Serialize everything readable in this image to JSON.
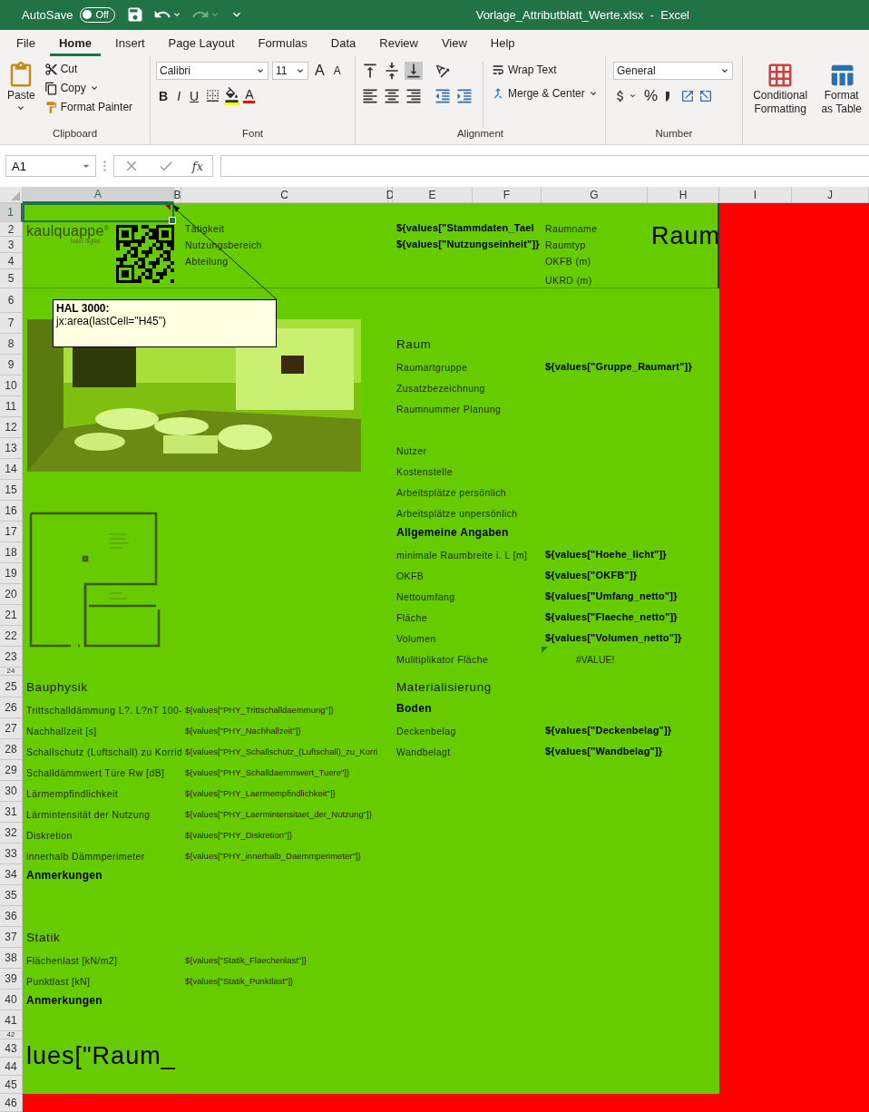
{
  "title_bar": {
    "autosave": {
      "label": "AutoSave",
      "on": false,
      "state_text": "Off"
    },
    "document_title": "Vorlage_Attributblatt_Werte.xlsx  -  Excel"
  },
  "menu_tabs": [
    {
      "label": "File",
      "selected": false
    },
    {
      "label": "Home",
      "selected": true
    },
    {
      "label": "Insert",
      "selected": false
    },
    {
      "label": "Page Layout",
      "selected": false
    },
    {
      "label": "Formulas",
      "selected": false
    },
    {
      "label": "Data",
      "selected": false
    },
    {
      "label": "Review",
      "selected": false
    },
    {
      "label": "View",
      "selected": false
    },
    {
      "label": "Help",
      "selected": false
    }
  ],
  "ribbon": {
    "clipboard": {
      "paste": "Paste",
      "cut": "Cut",
      "copy": "Copy",
      "format_painter": "Format Painter",
      "label": "Clipboard"
    },
    "font": {
      "font_name": "Calibri",
      "font_size": "11",
      "grow": "A",
      "shrink": "A",
      "bold": "B",
      "italic": "I",
      "underline": "U",
      "font_color": "A",
      "label": "Font"
    },
    "alignment": {
      "wrap_text": "Wrap Text",
      "merge_center": "Merge & Center",
      "label": "Alignment"
    },
    "number": {
      "format": "General",
      "percent": "%",
      "label": "Number"
    },
    "styles": [
      {
        "label": "Conditional Formatting"
      },
      {
        "label": "Format as Table"
      }
    ]
  },
  "formula_bar": {
    "name_box": "A1",
    "function_label": "fx"
  },
  "sheet": {
    "columns": [
      {
        "label": "A",
        "selected": true
      },
      {
        "label": "B",
        "selected": false
      },
      {
        "label": "C",
        "selected": false
      },
      {
        "label": "D",
        "selected": false
      },
      {
        "label": "E",
        "selected": false
      },
      {
        "label": "F",
        "selected": false
      },
      {
        "label": "G",
        "selected": false
      },
      {
        "label": "H",
        "selected": false
      },
      {
        "label": "I",
        "selected": false
      },
      {
        "label": "J",
        "selected": false
      }
    ],
    "rows": [
      {
        "label": "1",
        "selected": true
      },
      {
        "label": "2",
        "selected": false,
        "cells": {
          "C": {
            "kind": "label",
            "text": "Tätigkeit"
          },
          "E": {
            "kind": "bold",
            "text": "${values[\"Stammdaten_Tael"
          },
          "G": {
            "kind": "label",
            "text": "Raumname"
          },
          "H": {
            "kind": "title",
            "text": "Raum"
          }
        }
      },
      {
        "label": "3",
        "selected": false,
        "cells": {
          "C": {
            "kind": "label",
            "text": "Nutzungsbereich"
          },
          "E": {
            "kind": "bold",
            "text": "${values[\"Nutzungseinheit\"]}"
          },
          "G": {
            "kind": "label",
            "text": "Raumtyp"
          }
        }
      },
      {
        "label": "4",
        "selected": false,
        "cells": {
          "C": {
            "kind": "label",
            "text": "Abteilung"
          },
          "G": {
            "kind": "label",
            "text": "OKFB (m)"
          }
        }
      },
      {
        "label": "5",
        "selected": false,
        "cells": {
          "G": {
            "kind": "label",
            "text": "UKRD (m)"
          }
        }
      },
      {
        "label": "6",
        "selected": false
      },
      {
        "label": "7",
        "selected": false
      },
      {
        "label": "8",
        "selected": false,
        "cells": {
          "E": {
            "kind": "heading",
            "text": "Raum"
          }
        }
      },
      {
        "label": "9",
        "selected": false,
        "cells": {
          "E": {
            "kind": "label",
            "text": "Raumartgruppe"
          },
          "G": {
            "kind": "bold",
            "text": "${values[\"Gruppe_Raumart\"]}"
          }
        }
      },
      {
        "label": "10",
        "selected": false,
        "cells": {
          "E": {
            "kind": "label",
            "text": "Zusatzbezeichnung"
          }
        }
      },
      {
        "label": "11",
        "selected": false,
        "cells": {
          "E": {
            "kind": "label",
            "text": "Raumnummer Planung"
          }
        }
      },
      {
        "label": "12",
        "selected": false
      },
      {
        "label": "13",
        "selected": false,
        "cells": {
          "E": {
            "kind": "label",
            "text": "Nutzer"
          }
        }
      },
      {
        "label": "14",
        "selected": false,
        "cells": {
          "E": {
            "kind": "label",
            "text": "Kostenstelle"
          }
        }
      },
      {
        "label": "15",
        "selected": false,
        "cells": {
          "E": {
            "kind": "label",
            "text": "Arbeitsplätze persönlich"
          }
        }
      },
      {
        "label": "16",
        "selected": false,
        "cells": {
          "E": {
            "kind": "label",
            "text": "Arbeitsplätze unpersönlich"
          }
        }
      },
      {
        "label": "17",
        "selected": false,
        "cells": {
          "E": {
            "kind": "section",
            "text": "Allgemeine Angaben"
          }
        }
      },
      {
        "label": "18",
        "selected": false,
        "cells": {
          "E": {
            "kind": "label",
            "text": "minimale Raumbreite i. L [m]"
          },
          "G": {
            "kind": "bold",
            "text": "${values[\"Hoehe_licht\"]}"
          }
        }
      },
      {
        "label": "19",
        "selected": false,
        "cells": {
          "E": {
            "kind": "label",
            "text": "OKFB"
          },
          "G": {
            "kind": "bold",
            "text": "${values[\"OKFB\"]}"
          }
        }
      },
      {
        "label": "20",
        "selected": false,
        "cells": {
          "E": {
            "kind": "label",
            "text": "Nettoumfang"
          },
          "G": {
            "kind": "bold",
            "text": "${values[\"Umfang_netto\"]}"
          }
        }
      },
      {
        "label": "21",
        "selected": false,
        "cells": {
          "E": {
            "kind": "label",
            "text": "Fläche"
          },
          "G": {
            "kind": "bold",
            "text": "${values[\"Flaeche_netto\"]}"
          }
        }
      },
      {
        "label": "22",
        "selected": false,
        "cells": {
          "E": {
            "kind": "label",
            "text": "Volumen"
          },
          "G": {
            "kind": "bold",
            "text": "${values[\"Volumen_netto\"]}"
          }
        }
      },
      {
        "label": "23",
        "selected": false,
        "cells": {
          "E": {
            "kind": "label",
            "text": "Mulitiplikator Fläche"
          },
          "G": {
            "kind": "error",
            "text": "#VALUE!"
          }
        }
      },
      {
        "label": "24",
        "selected": false
      },
      {
        "label": "25",
        "selected": false,
        "cells": {
          "A": {
            "kind": "heading",
            "text": "Bauphysik"
          },
          "E": {
            "kind": "heading",
            "text": "Materialisierung"
          }
        }
      },
      {
        "label": "26",
        "selected": false,
        "cells": {
          "A": {
            "kind": "label",
            "text": "Trittschalldämmung L?. L?nT 100-"
          },
          "C": {
            "kind": "value",
            "text": "${values[\"PHY_Trittschalldaemmung\"]}"
          },
          "E": {
            "kind": "section",
            "text": "Boden"
          }
        }
      },
      {
        "label": "27",
        "selected": false,
        "cells": {
          "A": {
            "kind": "label",
            "text": "Nachhallzeit [s]"
          },
          "C": {
            "kind": "value",
            "text": "${values[\"PHY_Nachhallzeit\"]}"
          },
          "E": {
            "kind": "label",
            "text": "Deckenbelag"
          },
          "G": {
            "kind": "bold",
            "text": "${values[\"Deckenbelag\"]}"
          }
        }
      },
      {
        "label": "28",
        "selected": false,
        "cells": {
          "A": {
            "kind": "label",
            "text": "Schallschutz (Luftschall) zu Korrid"
          },
          "C": {
            "kind": "value",
            "text": "${values[\"PHY_Schallschutz_(Luftschall)_zu_Korri"
          },
          "E": {
            "kind": "label",
            "text": "Wandbelagt"
          },
          "G": {
            "kind": "bold",
            "text": "${values[\"Wandbelag\"]}"
          }
        }
      },
      {
        "label": "29",
        "selected": false,
        "cells": {
          "A": {
            "kind": "label",
            "text": "Schalldämmwert Türe Rw [dB]"
          },
          "C": {
            "kind": "value",
            "text": "${values[\"PHY_Schalldaemmwert_Tuere\"]}"
          }
        }
      },
      {
        "label": "30",
        "selected": false,
        "cells": {
          "A": {
            "kind": "label",
            "text": "Lärmempfindlichkeit"
          },
          "C": {
            "kind": "value",
            "text": "${values[\"PHY_Laermempfindlichkeit\"]}"
          }
        }
      },
      {
        "label": "31",
        "selected": false,
        "cells": {
          "A": {
            "kind": "label",
            "text": "Lärmintensität der Nutzung"
          },
          "C": {
            "kind": "value",
            "text": "${values[\"PHY_Laermintensitaet_der_Nutzung\"]}"
          }
        }
      },
      {
        "label": "32",
        "selected": false,
        "cells": {
          "A": {
            "kind": "label",
            "text": "Diskretion"
          },
          "C": {
            "kind": "value",
            "text": "${values[\"PHY_Diskretion\"]}"
          }
        }
      },
      {
        "label": "33",
        "selected": false,
        "cells": {
          "A": {
            "kind": "label",
            "text": "innerhalb Dämmperimeter"
          },
          "C": {
            "kind": "value",
            "text": "${values[\"PHY_innerhalb_Daemmperimeter\"]}"
          }
        }
      },
      {
        "label": "34",
        "selected": false,
        "cells": {
          "A": {
            "kind": "section",
            "text": "Anmerkungen"
          }
        }
      },
      {
        "label": "35",
        "selected": false
      },
      {
        "label": "36",
        "selected": false
      },
      {
        "label": "37",
        "selected": false,
        "cells": {
          "A": {
            "kind": "heading",
            "text": "Statik"
          }
        }
      },
      {
        "label": "38",
        "selected": false,
        "cells": {
          "A": {
            "kind": "label",
            "text": "Flächenlast [kN/m2]"
          },
          "C": {
            "kind": "value",
            "text": "${values[\"Statik_Flaechenlast\"]}"
          }
        }
      },
      {
        "label": "39",
        "selected": false,
        "cells": {
          "A": {
            "kind": "label",
            "text": "Punktlast [kN]"
          },
          "C": {
            "kind": "value",
            "text": "${values[\"Statik_Punktlast\"]}"
          }
        }
      },
      {
        "label": "40",
        "selected": false,
        "cells": {
          "A": {
            "kind": "section",
            "text": "Anmerkungen"
          }
        }
      },
      {
        "label": "41",
        "selected": false
      },
      {
        "label": "42",
        "selected": false
      },
      {
        "label": "43",
        "selected": false,
        "cells": {
          "A": {
            "kind": "title",
            "text": "lues[\"Raum_"
          }
        }
      },
      {
        "label": "44",
        "selected": false
      },
      {
        "label": "45",
        "selected": false
      },
      {
        "label": "46",
        "selected": false
      }
    ],
    "logo": {
      "name": "kaulquappe$^{®}$",
      "tagline": "build digital."
    },
    "comment": {
      "author": "HAL 3000:",
      "text": "jx:area(lastCell=\"H45\")"
    }
  }
}
